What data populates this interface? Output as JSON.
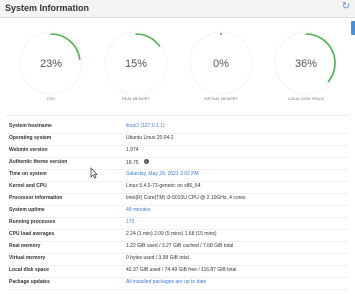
{
  "panel": {
    "title": "System Information",
    "reload_icon": "reload-icon",
    "accent_color": "#4a90d9"
  },
  "gauges": [
    {
      "id": "cpu",
      "label": "CPU",
      "value_text": "23%",
      "percent": 23
    },
    {
      "id": "real-memory",
      "label": "REAL MEMORY",
      "value_text": "15%",
      "percent": 15
    },
    {
      "id": "virtual-memory",
      "label": "VIRTUAL MEMORY",
      "value_text": "0%",
      "percent": 0
    },
    {
      "id": "local-disk-space",
      "label": "LOCAL DISK SPACE",
      "value_text": "36%",
      "percent": 36
    }
  ],
  "info": [
    {
      "label": "System hostname",
      "value": "linux2 (127.0.1.1)",
      "link": true
    },
    {
      "label": "Operating system",
      "value": "Ubuntu Linux 20.04.2",
      "link": false
    },
    {
      "label": "Webmin version",
      "value": "1.974",
      "link": false
    },
    {
      "label": "Authentic theme version",
      "value": "19.75",
      "link": false,
      "info_icon": true
    },
    {
      "label": "Time on system",
      "value": "Saturday, May 29, 2021 2:02 PM",
      "link": true
    },
    {
      "label": "Kernel and CPU",
      "value": "Linux 5.4.0-73-generic on x86_64",
      "link": false
    },
    {
      "label": "Processor information",
      "value": "Intel(R) Core(TM) i3-5010U CPU @ 2.10GHz, 4 cores",
      "link": false
    },
    {
      "label": "System uptime",
      "value": "49 minutes",
      "link": true
    },
    {
      "label": "Running processes",
      "value": "170",
      "link": true
    },
    {
      "label": "CPU load averages",
      "value": "2.24 (1 min) 2.09 (5 mins) 1.68 (15 mins)",
      "link": false
    },
    {
      "label": "Real memory",
      "value": "1.22 GiB used / 3.27 GiB cached / 7.68 GiB total",
      "link": false
    },
    {
      "label": "Virtual memory",
      "value": "0 bytes used / 3.99 GiB total",
      "link": false
    },
    {
      "label": "Local disk space",
      "value": "42.37 GiB used / 74.49 GiB free / 116.87 GiB total",
      "link": false
    },
    {
      "label": "Package updates",
      "value": "All installed packages are up to date",
      "link": true
    }
  ],
  "colors": {
    "gauge_arc": "#4caf50",
    "gauge_track": "#cfcfcf",
    "link": "#3a7bd5"
  }
}
